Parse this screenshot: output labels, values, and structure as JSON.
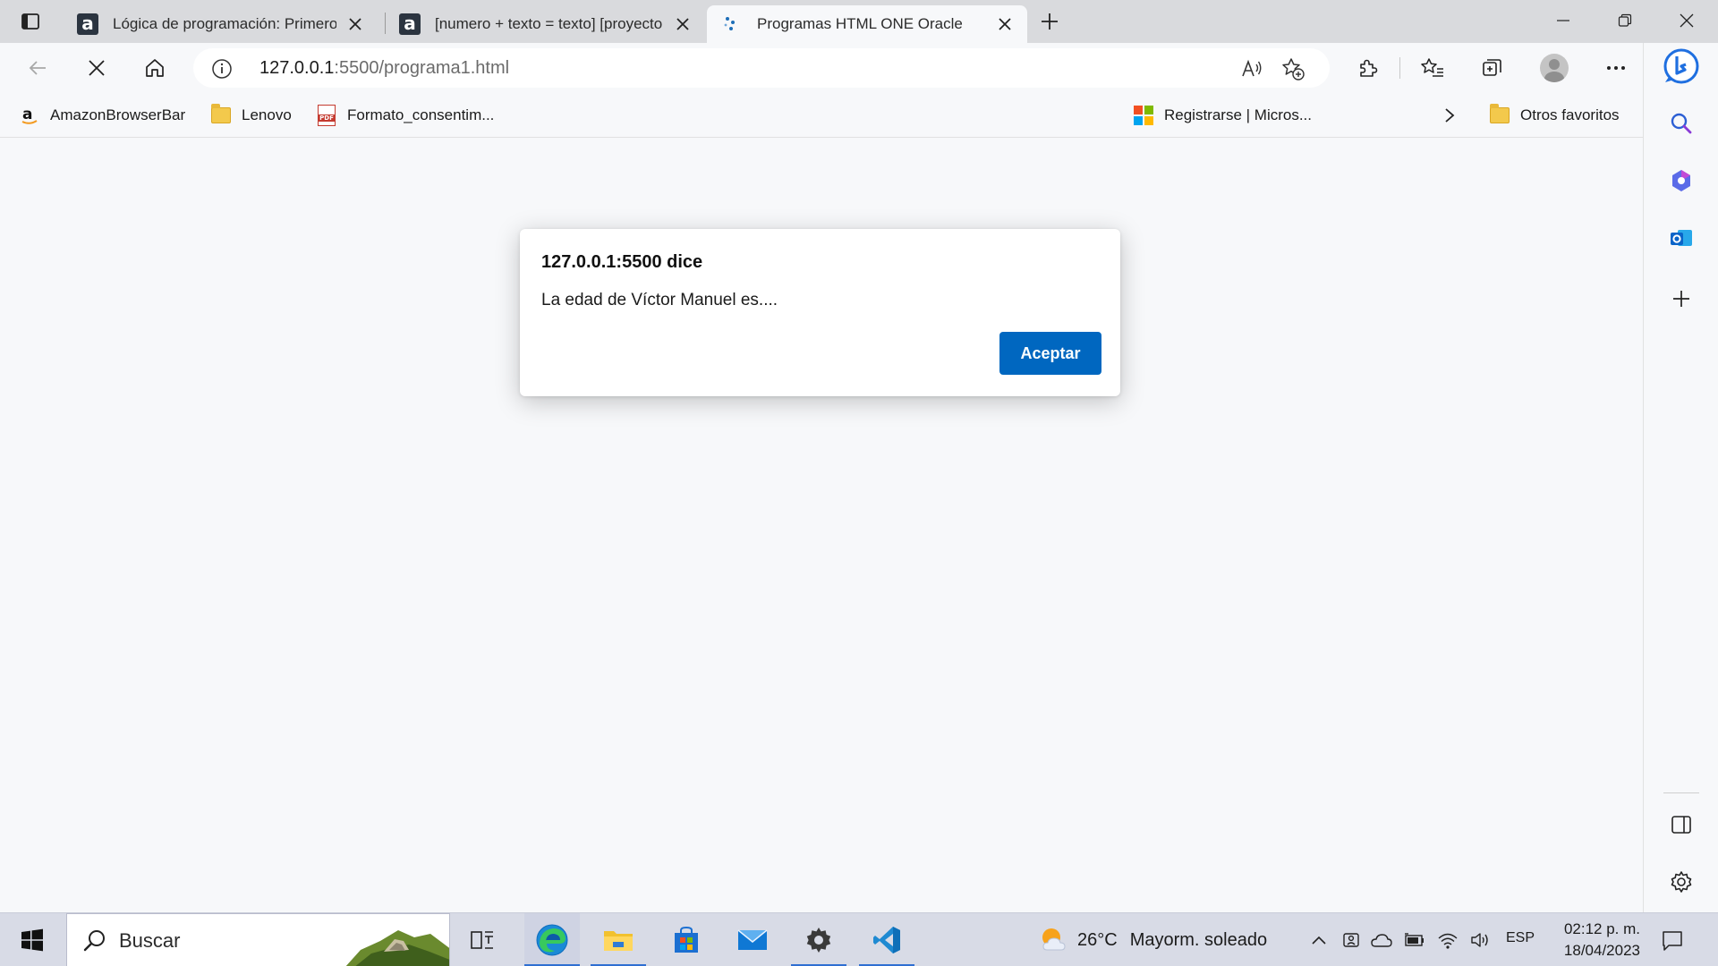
{
  "browser": {
    "tabs": [
      {
        "title": "Lógica de programación: Primeros pasos",
        "favicon": "alura-icon",
        "active": false
      },
      {
        "title": "[numero + texto = texto] [proyecto",
        "favicon": "alura-icon",
        "active": false
      },
      {
        "title": "Programas HTML ONE Oracle",
        "favicon": "loading-dots-icon",
        "active": true
      }
    ],
    "address": {
      "host": "127.0.0.1",
      "rest": ":5500/programa1.html"
    },
    "favorites": [
      {
        "label": "AmazonBrowserBar",
        "icon": "amazon-icon"
      },
      {
        "label": "Lenovo",
        "icon": "folder-icon"
      },
      {
        "label": "Formato_consentim...",
        "icon": "pdf-icon"
      },
      {
        "label": "Registrarse | Micros...",
        "icon": "microsoft-icon"
      },
      {
        "label": "Otros favoritos",
        "icon": "folder-icon"
      }
    ]
  },
  "dialog": {
    "title": "127.0.0.1:5500 dice",
    "message": "La edad de Víctor Manuel es....",
    "ok_label": "Aceptar"
  },
  "taskbar": {
    "search_placeholder": "Buscar",
    "weather": {
      "temp": "26°C",
      "condition": "Mayorm. soleado"
    },
    "language": "ESP",
    "time": "02:12 p. m.",
    "date": "18/04/2023"
  },
  "colors": {
    "accent": "#0067c0",
    "tabstrip": "#d9dadd",
    "page": "#f7f8fa",
    "taskbar": "#d8dbe6"
  }
}
